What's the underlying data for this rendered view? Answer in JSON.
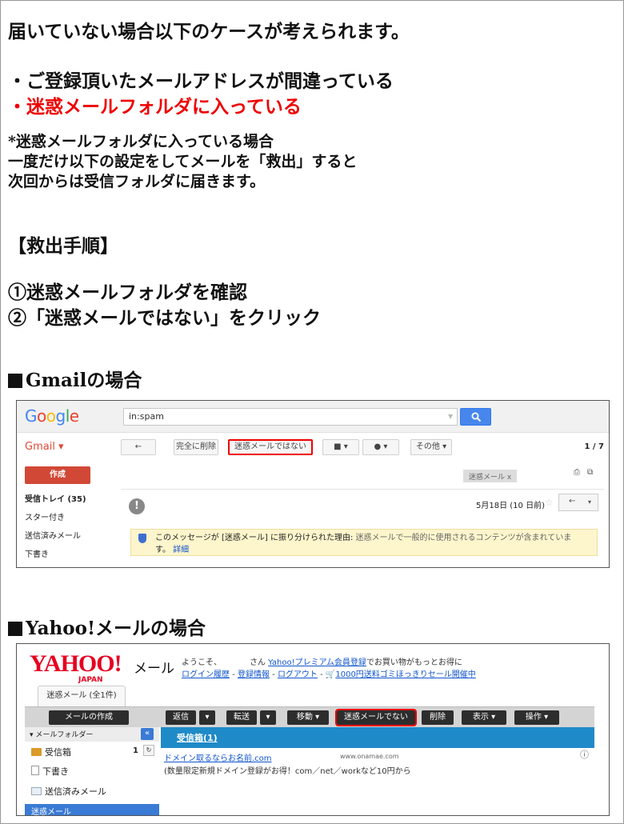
{
  "intro": {
    "line1": "届いていない場合以下のケースが考えられます。",
    "case1": "・ご登録頂いたメールアドレスが間違っている",
    "case2": "・迷惑メールフォルダに入っている",
    "note1": "*迷惑メールフォルダに入っている場合",
    "note2": "一度だけ以下の設定をしてメールを「救出」すると",
    "note3": "次回からは受信フォルダに届きます。"
  },
  "steps": {
    "heading": "【救出手順】",
    "step1": "①迷惑メールフォルダを確認",
    "step2": "②「迷惑メールではない」をクリック"
  },
  "gmail_section": {
    "heading": "Gmailの場合"
  },
  "gmail": {
    "logo": "Google",
    "search_value": "in:spam",
    "brand": "Gmail ▾",
    "back_label": "←",
    "delete_label": "完全に削除",
    "not_spam_label": "迷惑メールではない",
    "folder_label": "■ ▾",
    "tag_label": "● ▾",
    "more_label": "その他 ▾",
    "page_count": "1 / 7",
    "compose_label": "作成",
    "nav": [
      "受信トレイ (35)",
      "スター付き",
      "送信済みメール",
      "下書き"
    ],
    "spam_chip": "迷惑メール   x",
    "print_icon": "⎙",
    "newwin_icon": "⧉",
    "avatar_glyph": "!",
    "date": "5月18日 (10 日前)",
    "star": "☆",
    "reply_label": "←",
    "reply_more": "▾",
    "warning_lead": "このメッセージが [迷惑メール] に振り分けられた理由:",
    "warning_body": " 迷惑メールで一般的に使用されるコンテンツが含まれていま",
    "warning_cont": "す。",
    "warning_link": "詳細"
  },
  "yahoo_section": {
    "heading": "Yahoo!メールの場合"
  },
  "yahoo": {
    "logo": "YAHOO!",
    "logo_sub": "JAPAN",
    "mail_label": "メール",
    "welcome_text": "ようこそ、           さん ",
    "premium_link": "Yahoo!プレミアム会員登録",
    "premium_tail": "でお買い物がもっとお得に",
    "link_history": "ログイン履歴",
    "link_register": "登録情報",
    "link_logout": "ログアウト",
    "link_sale": "1000円送料ゴミほっきりセール開催中",
    "link_sep": " - ",
    "tab_label": "迷惑メール (全1件)",
    "compose_label": "メールの作成",
    "reply_label": "返信",
    "forward_label": "転送",
    "move_label": "移動 ▾",
    "not_spam_label": "迷惑メールでない",
    "delete_label": "削除",
    "view_label": "表示 ▾",
    "action_label": "操作 ▾",
    "caret": "▾",
    "side_title": "▾ メールフォルダー",
    "collapse_icon": "«",
    "folders": [
      "受信箱",
      "下書き",
      "送信済みメール"
    ],
    "inbox_count": "1",
    "refresh_icon": "↻",
    "spam_folder": "迷惑メール",
    "main_head": "受信箱(1)",
    "ad_link": "ドメイン取るならお名前.com",
    "ad_url": "www.onamae.com",
    "ad_text": "(数量限定新規ドメイン登録がお得！com／net／workなど10円から",
    "ad_icon": "ⓘ"
  }
}
